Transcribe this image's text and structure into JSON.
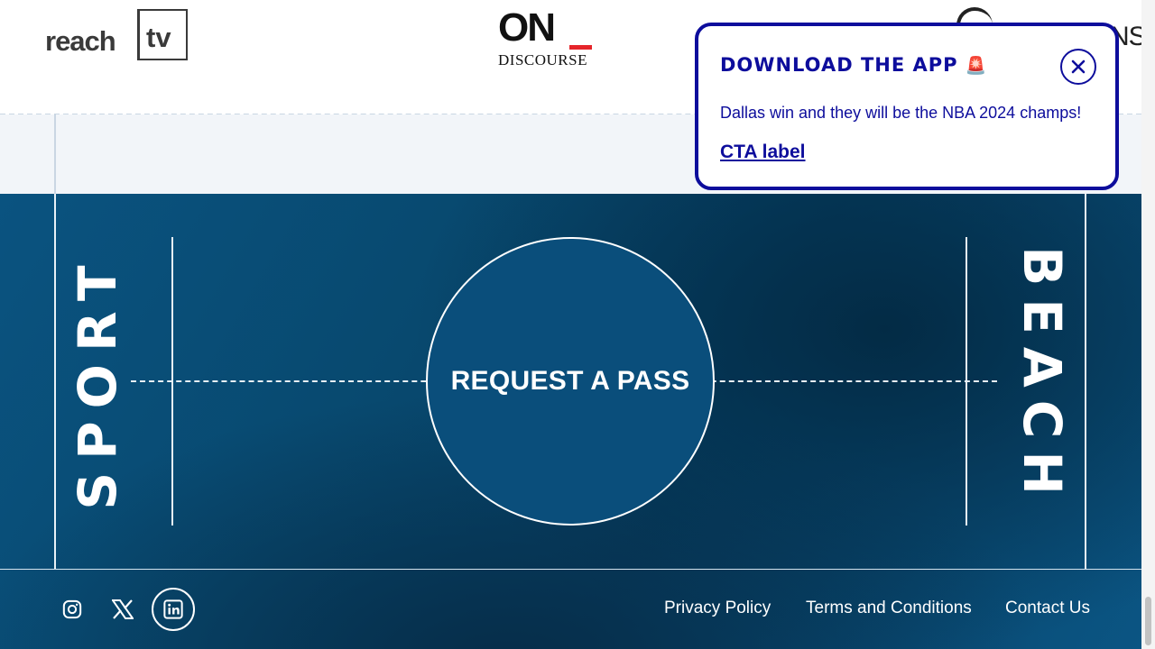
{
  "logos": {
    "reach": {
      "word": "reach",
      "box_word": "tv"
    },
    "on_discourse": {
      "word": "ON",
      "sub": "DISCOURSE"
    },
    "third": {
      "visible_text": "NS"
    }
  },
  "court": {
    "left_word": "SPORT",
    "right_word": "BEACH",
    "center_button": "REQUEST A PASS"
  },
  "footer": {
    "social": [
      {
        "icon": "instagram-icon"
      },
      {
        "icon": "x-icon"
      },
      {
        "icon": "linkedin-icon"
      }
    ],
    "links": [
      {
        "label": "Privacy Policy"
      },
      {
        "label": "Terms and Conditions"
      },
      {
        "label": "Contact Us"
      }
    ]
  },
  "popup": {
    "title": "DOWNLOAD THE APP",
    "title_emoji": "🚨",
    "body": "Dallas win and they will be the NBA 2024 champs!",
    "cta": "CTA label",
    "close_icon": "close-icon"
  },
  "colors": {
    "popup_accent": "#0d0d9c",
    "court_blue": "#08496f",
    "on_red": "#e5252a"
  }
}
